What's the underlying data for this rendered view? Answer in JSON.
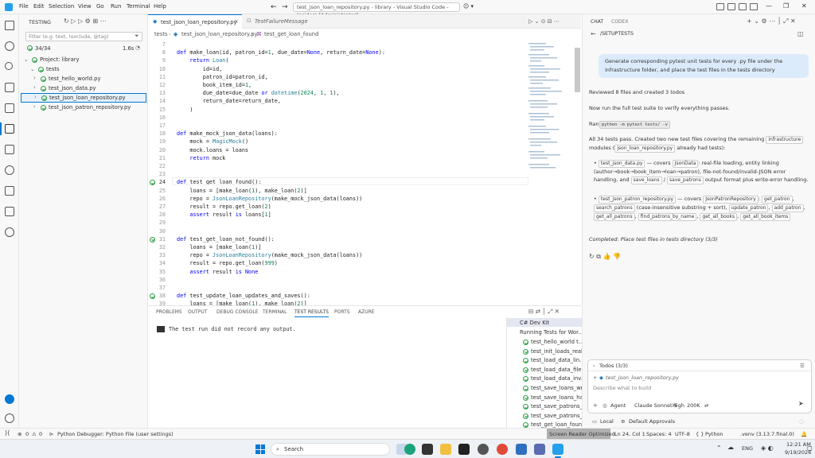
{
  "titlebar": {
    "menus": [
      "File",
      "Edit",
      "Selection",
      "View",
      "Go",
      "Run",
      "Terminal",
      "Help"
    ],
    "search": "test_json_loan_repository.py - library - Visual Studio Code - Insiders [Administrator]"
  },
  "sidebar": {
    "header": "TESTING",
    "filter_placeholder": "Filter (e.g. text, !exclude, @tag)",
    "count": "34/34",
    "duration": "1.6s",
    "tree": [
      {
        "label": "Project: library",
        "indent": 0
      },
      {
        "label": "tests",
        "indent": 1
      },
      {
        "label": "test_hello_world.py",
        "indent": 2
      },
      {
        "label": "test_json_data.py",
        "indent": 2
      },
      {
        "label": "test_json_loan_repository.py",
        "indent": 2
      },
      {
        "label": "test_json_patron_repository.py",
        "indent": 2
      }
    ]
  },
  "tabs": [
    {
      "label": "test_json_loan_repository.py",
      "active": true
    },
    {
      "label": "TestFailureMessage",
      "active": false
    }
  ],
  "breadcrumb": [
    "tests",
    "test_json_loan_repository.py",
    "test_get_loan_found"
  ],
  "code": [
    {
      "n": "7",
      "t": ""
    },
    {
      "n": "8",
      "t": "def make_loan(id, patron_id=1, due_date=None, return_date=None):"
    },
    {
      "n": "9",
      "t": "    return Loan("
    },
    {
      "n": "10",
      "t": "        id=id,"
    },
    {
      "n": "11",
      "t": "        patron_id=patron_id,"
    },
    {
      "n": "12",
      "t": "        book_item_id=1,"
    },
    {
      "n": "13",
      "t": "        due_date=due_date or datetime(2024, 1, 1),"
    },
    {
      "n": "14",
      "t": "        return_date=return_date,"
    },
    {
      "n": "15",
      "t": "    )"
    },
    {
      "n": "16",
      "t": ""
    },
    {
      "n": "17",
      "t": ""
    },
    {
      "n": "18",
      "t": "def make_mock_json_data(loans):"
    },
    {
      "n": "19",
      "t": "    mock = MagicMock()"
    },
    {
      "n": "20",
      "t": "    mock.loans = loans"
    },
    {
      "n": "21",
      "t": "    return mock"
    },
    {
      "n": "22",
      "t": ""
    },
    {
      "n": "23",
      "t": ""
    },
    {
      "n": "24",
      "t": "def test_get_loan_found():"
    },
    {
      "n": "25",
      "t": "    loans = [make_loan(1), make_loan(2)]"
    },
    {
      "n": "26",
      "t": "    repo = JsonLoanRepository(make_mock_json_data(loans))"
    },
    {
      "n": "27",
      "t": "    result = repo.get_loan(2)"
    },
    {
      "n": "28",
      "t": "    assert result is loans[1]"
    },
    {
      "n": "29",
      "t": ""
    },
    {
      "n": "30",
      "t": ""
    },
    {
      "n": "31",
      "t": "def test_get_loan_not_found():"
    },
    {
      "n": "32",
      "t": "    loans = [make_loan(1)]"
    },
    {
      "n": "33",
      "t": "    repo = JsonLoanRepository(make_mock_json_data(loans))"
    },
    {
      "n": "34",
      "t": "    result = repo.get_loan(999)"
    },
    {
      "n": "35",
      "t": "    assert result is None"
    },
    {
      "n": "36",
      "t": ""
    },
    {
      "n": "37",
      "t": ""
    },
    {
      "n": "38",
      "t": "def test_update_loan_updates_and_saves():"
    },
    {
      "n": "39",
      "t": "    loans = [make_loan(1), make_loan(2)]"
    }
  ],
  "panel": {
    "tabs": [
      "PROBLEMS",
      "OUTPUT",
      "DEBUG CONSOLE",
      "TERMINAL",
      "TEST RESULTS",
      "PORTS",
      "AZURE"
    ],
    "message": "The test run did not record any output.",
    "results_header": "C# Dev Kit",
    "results_sub": "Running Tests for Wor...",
    "results": [
      "test_hello_world  t...",
      "test_init_loads_real...",
      "test_load_data_lin...",
      "test_load_data_file...",
      "test_load_data_inv...",
      "test_save_loans_wr...",
      "test_save_loans_ha...",
      "test_save_patrons_...",
      "test_save_patrons_...",
      "test_get_loan_foun..."
    ]
  },
  "chat": {
    "tabs": [
      "CHAT",
      "CODEX"
    ],
    "title": "/SETUPTESTS",
    "prompt": "Generate corresponding pytest unit tests for every .py file under the infrastructure folder, and place the test files in the tests directory",
    "reviewed": "Reviewed 8 files and created 3 todos",
    "run_full": "Now run the full test suite to verify everything passes.",
    "ran_label": "Ran",
    "ran_cmd": "python -m pytest tests/ -v",
    "summary_a": "All 34 tests pass. Created two new test files covering the remaining",
    "summary_chip": "infrastructure",
    "summary_b": "modules (",
    "summary_chip2": "json_loan_repository.py",
    "summary_c": "already had tests):",
    "b1_file": "test_json_data.py",
    "b1_text": "— covers",
    "b1_chip": "JsonData",
    "b1_rest": ": real-file loading, entity linking (author→book→book_item→loan→patron), file-not-found/invalid-JSON error handling, and",
    "b1_chip2": "save_loans",
    "b1_slash": "/",
    "b1_chip3": "save_patrons",
    "b1_end": "output format plus write-error handling.",
    "b2_file": "test_json_patron_repository.py",
    "b2_text": "— covers",
    "b2_chips": [
      "JsonPatronRepository",
      "get_patron",
      "search_patrons",
      "update_patron",
      "add_patron",
      "get_all_patrons",
      "find_patrons_by_name",
      "get_all_books",
      "get_all_book_items"
    ],
    "b2_note": "(case-insensitive substring + sort),",
    "completed": "Completed: Place test files in tests directory (3/3)",
    "todos": "Todos (3/3)",
    "attached": "test_json_loan_repository.py",
    "input_placeholder": "Describe what to build",
    "agent": "Agent",
    "model": "Claude Sonnet 5",
    "effort": "High",
    "ctx": "200K",
    "local": "Local",
    "approvals": "Default Approvals"
  },
  "status": {
    "errors": "0",
    "warnings": "0",
    "debugger": "Python Debugger: Python File (user settings)",
    "screen_reader": "Screen Reader Optimized",
    "position": "Ln 24, Col 1",
    "spaces": "Spaces: 4",
    "encoding": "UTF-8",
    "language": "Python",
    "env": ".venv (3.13.7.final.0)"
  },
  "taskbar": {
    "search": "Search",
    "lang": "ENG",
    "time": "12:21 AM",
    "date": "9/19/2026"
  },
  "colors": {
    "accent": "#0078d4",
    "pass": "#2e9e44",
    "screen_reader_bg": "#b0b0b0"
  }
}
